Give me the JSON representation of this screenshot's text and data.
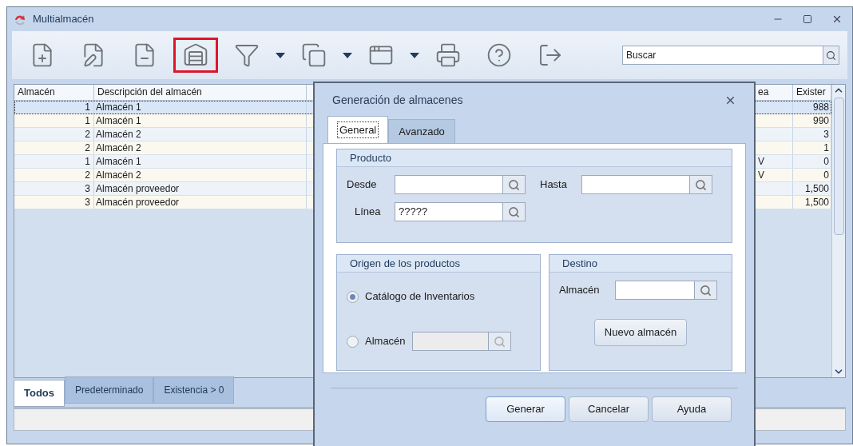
{
  "window": {
    "title": "Multialmacén"
  },
  "toolbar": [
    {
      "kind": "new",
      "highlighted": false,
      "dropdown": false
    },
    {
      "kind": "edit",
      "highlighted": false,
      "dropdown": false
    },
    {
      "kind": "delete",
      "highlighted": false,
      "dropdown": false
    },
    {
      "kind": "warehouse",
      "highlighted": true,
      "dropdown": false
    },
    {
      "kind": "filter",
      "highlighted": false,
      "dropdown": true
    },
    {
      "kind": "copy",
      "highlighted": false,
      "dropdown": true
    },
    {
      "kind": "windows",
      "highlighted": false,
      "dropdown": true
    },
    {
      "kind": "print",
      "highlighted": false,
      "dropdown": false
    },
    {
      "kind": "help",
      "highlighted": false,
      "dropdown": false
    },
    {
      "kind": "exit",
      "highlighted": false,
      "dropdown": false
    }
  ],
  "search": {
    "placeholder": "Buscar"
  },
  "table": {
    "columns": [
      "Almacén",
      "Descripción del almacén",
      "ea",
      "Exister"
    ],
    "rows": [
      {
        "almacen": "1",
        "descripcion": "Almacén 1",
        "existencia": "988",
        "selected": true
      },
      {
        "almacen": "1",
        "descripcion": "Almacén 1",
        "existencia": "990",
        "selected": false
      },
      {
        "almacen": "2",
        "descripcion": "Almacén 2",
        "existencia": "3",
        "selected": false
      },
      {
        "almacen": "2",
        "descripcion": "Almacén 2",
        "existencia": "1",
        "selected": false
      },
      {
        "almacen": "1",
        "descripcion": "Almacén 1",
        "column_4": "V",
        "existencia": "0",
        "selected": false
      },
      {
        "almacen": "2",
        "descripcion": "Almacén 2",
        "column_4": "V",
        "existencia": "0",
        "selected": false
      },
      {
        "almacen": "3",
        "descripcion": "Almacén proveedor",
        "existencia": "1,500",
        "selected": false
      },
      {
        "almacen": "3",
        "descripcion": "Almacén proveedor",
        "existencia": "1,500",
        "selected": false
      }
    ]
  },
  "bottom_tabs": [
    {
      "label": "Todos",
      "selected": true
    },
    {
      "label": "Predeterminado",
      "selected": false
    },
    {
      "label": "Existencia > 0",
      "selected": false
    }
  ],
  "dialog": {
    "title": "Generación de almacenes",
    "tabs": [
      {
        "label": "General",
        "selected": true
      },
      {
        "label": "Avanzado",
        "selected": false
      }
    ],
    "producto": {
      "title": "Producto",
      "desde": {
        "label": "Desde"
      },
      "hasta": {
        "label": "Hasta"
      },
      "linea": {
        "label": "Línea",
        "value": "?????"
      }
    },
    "origen": {
      "title": "Origen de los productos",
      "options": [
        {
          "kind": "plain",
          "label": "Catálogo de Inventarios",
          "selected": true
        },
        {
          "kind": "lookup",
          "label": "Almacén",
          "selected": false
        }
      ]
    },
    "destino": {
      "title": "Destino",
      "almacen": {
        "label": "Almacén"
      },
      "button": "Nuevo almacén"
    },
    "buttons": [
      {
        "label": "Generar",
        "default": true
      },
      {
        "label": "Cancelar",
        "default": false
      },
      {
        "label": "Ayuda",
        "default": false
      }
    ]
  }
}
